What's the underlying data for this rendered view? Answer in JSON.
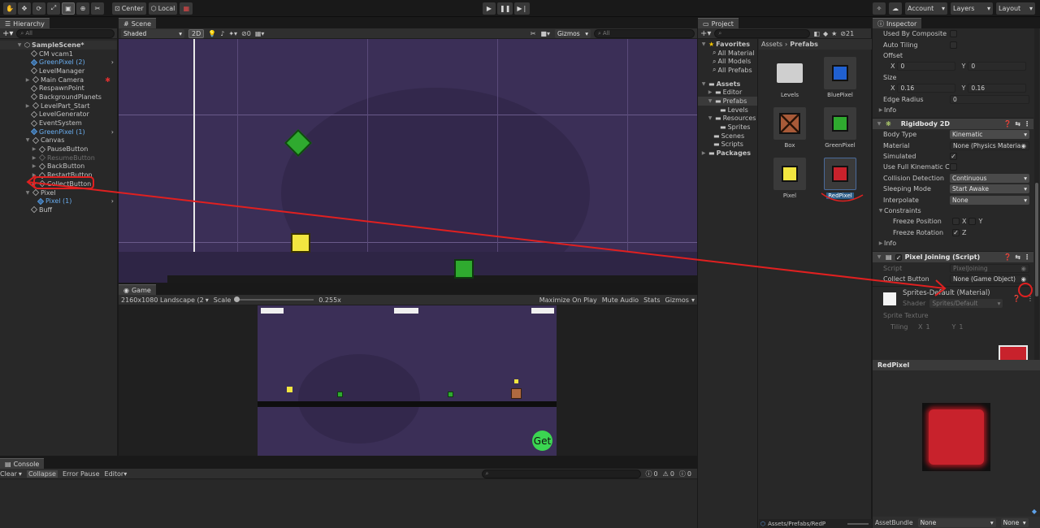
{
  "toolbar": {
    "tools": [
      "hand-icon",
      "move-icon",
      "rotate-icon",
      "scale-icon",
      "rect-icon",
      "transform-icon",
      "custom-tool-icon"
    ],
    "pivot_label": "Center",
    "space_label": "Local",
    "account_label": "Account",
    "layers_label": "Layers",
    "layout_label": "Layout"
  },
  "hierarchy": {
    "tab": "Hierarchy",
    "search_placeholder": "All",
    "scene_name": "SampleScene*",
    "items": [
      {
        "label": "CM vcam1"
      },
      {
        "label": "GreenPixel (2)"
      },
      {
        "label": "LevelManager"
      },
      {
        "label": "Main Camera"
      },
      {
        "label": "RespawnPoint"
      },
      {
        "label": "BackgroundPlanets"
      },
      {
        "label": "LevelPart_Start"
      },
      {
        "label": "LevelGenerator"
      },
      {
        "label": "EventSystem"
      },
      {
        "label": "GreenPixel (1)"
      },
      {
        "label": "Canvas"
      },
      {
        "label": "PauseButton"
      },
      {
        "label": "ResumeButton"
      },
      {
        "label": "BackButton"
      },
      {
        "label": "RestartButton"
      },
      {
        "label": "CollectButton"
      },
      {
        "label": "Pixel"
      },
      {
        "label": "Pixel (1)"
      },
      {
        "label": "Buff"
      }
    ]
  },
  "scene": {
    "tab": "Scene",
    "shading": "Shaded",
    "mode_2d": "2D",
    "fx_count": "0",
    "gizmos": "Gizmos",
    "search_placeholder": "All"
  },
  "game": {
    "tab": "Game",
    "resolution": "2160x1080 Landscape (2",
    "scale_label": "Scale",
    "scale_value": "0.255x",
    "maximize": "Maximize On Play",
    "mute": "Mute Audio",
    "stats": "Stats",
    "gizmos": "Gizmos",
    "get_button": "Get"
  },
  "project": {
    "tab": "Project",
    "favorites": "Favorites",
    "fav_items": [
      "All Material",
      "All Models",
      "All Prefabs"
    ],
    "assets": "Assets",
    "asset_folders": [
      "Editor",
      "Prefabs",
      "Levels",
      "Resources",
      "Sprites",
      "Scenes",
      "Scripts"
    ],
    "packages": "Packages",
    "breadcrumb_root": "Assets",
    "breadcrumb_leaf": "Prefabs",
    "tile_items": [
      {
        "label": "Levels"
      },
      {
        "label": "BluePixel"
      },
      {
        "label": "Box"
      },
      {
        "label": "GreenPixel"
      },
      {
        "label": "Pixel"
      },
      {
        "label": "RedPixel"
      }
    ],
    "hidden_count": "21",
    "path": "Assets/Prefabs/RedP"
  },
  "inspector": {
    "tab": "Inspector",
    "used_by_composite": "Used By Composite",
    "auto_tiling": "Auto Tiling",
    "offset": "Offset",
    "offset_x": "0",
    "offset_y": "0",
    "size": "Size",
    "size_x": "0.16",
    "size_y": "0.16",
    "edge_radius": "Edge Radius",
    "edge_radius_value": "0",
    "info": "Info",
    "rb_title": "Rigidbody 2D",
    "body_type": "Body Type",
    "body_type_value": "Kinematic",
    "material": "Material",
    "material_value": "None (Physics Materia",
    "simulated": "Simulated",
    "full_kinematic": "Use Full Kinematic Co",
    "collision": "Collision Detection",
    "collision_value": "Continuous",
    "sleeping": "Sleeping Mode",
    "sleeping_value": "Start Awake",
    "interpolate": "Interpolate",
    "interpolate_value": "None",
    "constraints": "Constraints",
    "freeze_pos": "Freeze Position",
    "freeze_rot": "Freeze Rotation",
    "axis_x": "X",
    "axis_y": "Y",
    "axis_z": "Z",
    "info2": "Info",
    "script_title": "Pixel Joining (Script)",
    "script": "Script",
    "script_value": "PixelJoining",
    "collect_button": "Collect Button",
    "collect_value": "None (Game Object)",
    "mat_title": "Sprites-Default (Material)",
    "shader": "Shader",
    "shader_value": "Sprites/Default",
    "sprite_texture": "Sprite Texture",
    "tiling": "Tiling",
    "tiling_x": "1",
    "tiling_y": "1",
    "preview_title": "RedPixel",
    "asset_bundle": "AssetBundle",
    "bundle_value": "None",
    "bundle_variant": "None"
  },
  "console": {
    "tab": "Console",
    "clear": "Clear",
    "collapse": "Collapse",
    "error_pause": "Error Pause",
    "editor": "Editor",
    "count_log": "0",
    "count_warn": "0",
    "count_err": "0"
  },
  "colors": {
    "scene_bg": "#3b2f57",
    "annotation": "#e02020",
    "green": "#2faa2f",
    "yellow": "#f2e640",
    "red": "#c8222c",
    "blue": "#2060d0"
  }
}
